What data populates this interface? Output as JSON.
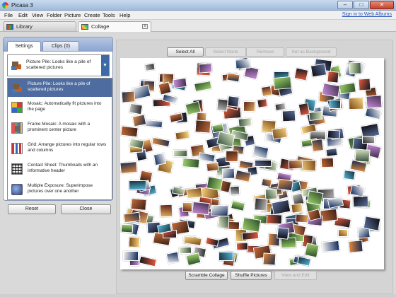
{
  "window": {
    "title": "Picasa 3",
    "minimize_label": "–",
    "maximize_label": "□",
    "close_label": "✕"
  },
  "menu": {
    "items": [
      "File",
      "Edit",
      "View",
      "Folder",
      "Picture",
      "Create",
      "Tools",
      "Help"
    ],
    "sign_in": "Sign in to Web Albums"
  },
  "tabs": {
    "library": "Library",
    "collage": "Collage",
    "collage_close": "x"
  },
  "panel": {
    "tabs": {
      "settings": "Settings",
      "clips": "Clips (0)"
    },
    "selected_layout": "Picture Pile:  Looks like a pile of scattered pictures",
    "dropdown_arrow": "▼",
    "options": [
      {
        "icon": "picture-pile-icon",
        "label": "Picture Pile:  Looks like a pile of scattered pictures",
        "selected": true
      },
      {
        "icon": "mosaic-icon",
        "label": "Mosaic:  Automatically fit pictures into the page",
        "selected": false
      },
      {
        "icon": "frame-mosaic-icon",
        "label": "Frame Mosaic: A mosaic with a prominent center picture",
        "selected": false
      },
      {
        "icon": "grid-icon",
        "label": "Grid:  Arrange pictures into regular rows and columns",
        "selected": false
      },
      {
        "icon": "contact-sheet-icon",
        "label": "Contact Sheet:  Thumbnails with an informative header",
        "selected": false
      },
      {
        "icon": "multiple-exposure-icon",
        "label": "Multiple Exposure:  Superimpose pictures over one another",
        "selected": false
      }
    ],
    "reset_label": "Reset",
    "close_label": "Close"
  },
  "toolbar": {
    "select_all": "Select All",
    "select_none": "Select None",
    "remove": "Remove",
    "set_background": "Set as Background"
  },
  "bottom": {
    "scramble": "Scramble Collage",
    "shuffle": "Shuffle Pictures",
    "view_edit": "View and Edit"
  }
}
